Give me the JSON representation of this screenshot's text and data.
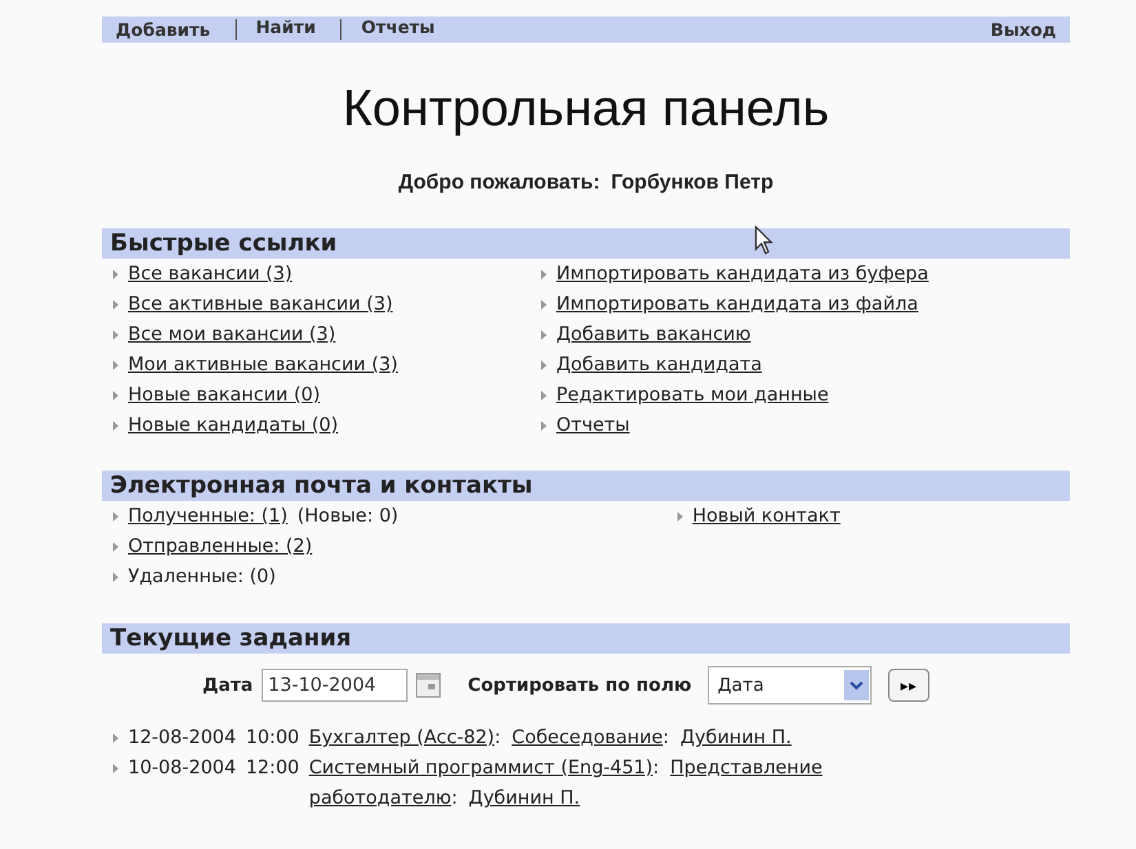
{
  "top_menu": {
    "items": [
      "Добавить",
      "Найти",
      "Отчеты"
    ],
    "logout": "Выход"
  },
  "title": "Контрольная панель",
  "welcome": {
    "label": "Добро пожаловать:",
    "user": "Горбунков Петр"
  },
  "quick_links": {
    "title": "Быстрые ссылки",
    "columns": [
      [
        "Все вакансии (3)",
        "Все активные вакансии (3)",
        "Все мои вакансии (3)",
        "Мои активные вакансии (3)",
        "Новые вакансии (0)",
        "Новые кандидаты (0)"
      ],
      [
        "Импортировать кандидата из буфера",
        "Импортировать кандидата из файла",
        "Добавить вакансию",
        "Добавить кандидата",
        "Редактировать мои данные",
        "Отчеты"
      ]
    ]
  },
  "email": {
    "title": "Электронная почта и контакты",
    "items": [
      {
        "link": "Полученные: (1)",
        "note": "(Новые: 0)"
      },
      {
        "link": "Отправленные: (2)"
      },
      {
        "text": "Удаленные: (0)"
      }
    ],
    "contact_link": "Новый контакт"
  },
  "tasks": {
    "title": "Текущие задания",
    "date_label": "Дата",
    "date_value": "13-10-2004",
    "sort_label": "Сортировать по полю",
    "sort_value": "Дата",
    "go_button": "▸▸",
    "separator": ":",
    "rows": [
      {
        "date": "12-08-2004",
        "time": "10:00",
        "job": "Бухгалтер (Acc-82)",
        "event": "Собеседование",
        "person": "Дубинин П."
      },
      {
        "date": "10-08-2004",
        "time": "12:00",
        "job": "Системный программист (Eng-451)",
        "event": "Представление работодателю",
        "person": "Дубинин П."
      }
    ]
  }
}
